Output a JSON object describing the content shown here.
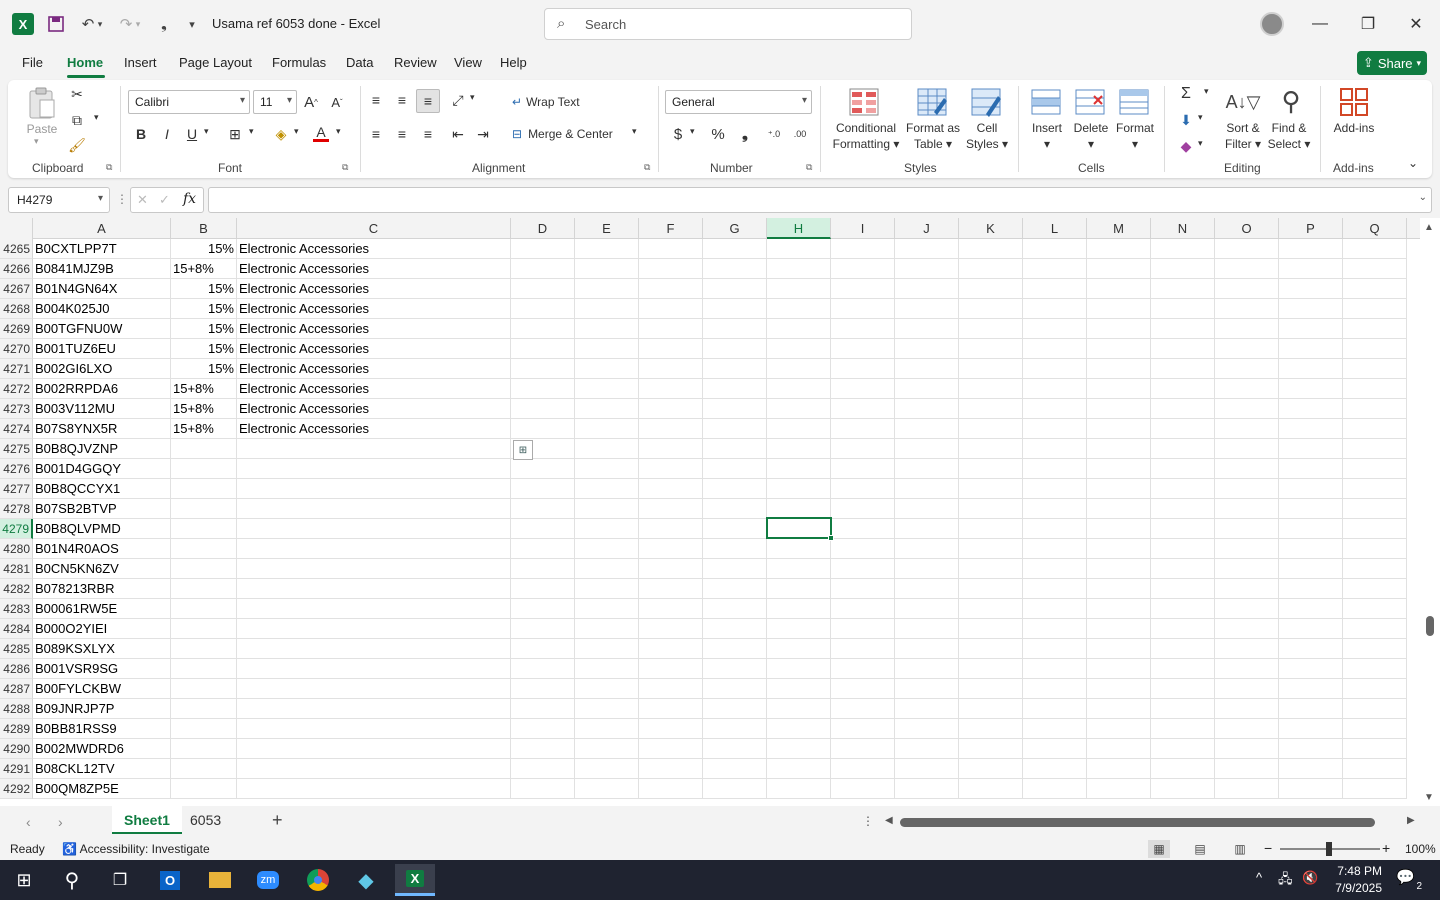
{
  "window": {
    "title": "Usama ref 6053 done  -  Excel",
    "search_placeholder": "Search"
  },
  "menu": {
    "tabs": [
      "File",
      "Home",
      "Insert",
      "Page Layout",
      "Formulas",
      "Data",
      "Review",
      "View",
      "Help"
    ],
    "share_label": "Share"
  },
  "ribbon": {
    "clipboard": {
      "paste": "Paste",
      "group": "Clipboard"
    },
    "font": {
      "name": "Calibri",
      "size": "11",
      "group": "Font"
    },
    "alignment": {
      "wrap": "Wrap Text",
      "merge": "Merge & Center",
      "group": "Alignment"
    },
    "number": {
      "format": "General",
      "group": "Number"
    },
    "styles": {
      "conditional_1": "Conditional",
      "conditional_2": "Formatting",
      "format_table_1": "Format as",
      "format_table_2": "Table",
      "cell_styles_1": "Cell",
      "cell_styles_2": "Styles",
      "group": "Styles"
    },
    "cells": {
      "insert": "Insert",
      "delete": "Delete",
      "format": "Format",
      "group": "Cells"
    },
    "editing": {
      "sort_1": "Sort &",
      "sort_2": "Filter",
      "find_1": "Find &",
      "find_2": "Select",
      "group": "Editing"
    },
    "addins": {
      "label": "Add-ins",
      "group": "Add-ins"
    }
  },
  "formula_bar": {
    "name_box": "H4279",
    "fx": "fx",
    "value": ""
  },
  "grid": {
    "columns": [
      "A",
      "B",
      "C",
      "D",
      "E",
      "F",
      "G",
      "H",
      "I",
      "J",
      "K",
      "L",
      "M",
      "N",
      "O",
      "P",
      "Q"
    ],
    "selected_column": "H",
    "selected_row": "4279",
    "rows": [
      {
        "num": "4265",
        "a": "B0CXTLPP7T",
        "b": "15%",
        "c": "Electronic Accessories"
      },
      {
        "num": "4266",
        "a": "B0841MJZ9B",
        "b": "15+8%",
        "c": "Electronic Accessories"
      },
      {
        "num": "4267",
        "a": "B01N4GN64X",
        "b": "15%",
        "c": "Electronic Accessories"
      },
      {
        "num": "4268",
        "a": "B004K025J0",
        "b": "15%",
        "c": "Electronic Accessories"
      },
      {
        "num": "4269",
        "a": "B00TGFNU0W",
        "b": "15%",
        "c": "Electronic Accessories"
      },
      {
        "num": "4270",
        "a": "B001TUZ6EU",
        "b": "15%",
        "c": "Electronic Accessories"
      },
      {
        "num": "4271",
        "a": "B002GI6LXO",
        "b": "15%",
        "c": "Electronic Accessories"
      },
      {
        "num": "4272",
        "a": "B002RRPDA6",
        "b": "15+8%",
        "c": "Electronic Accessories"
      },
      {
        "num": "4273",
        "a": "B003V112MU",
        "b": "15+8%",
        "c": "Electronic Accessories"
      },
      {
        "num": "4274",
        "a": "B07S8YNX5R",
        "b": "15+8%",
        "c": "Electronic Accessories"
      },
      {
        "num": "4275",
        "a": "B0B8QJVZNP",
        "b": "",
        "c": ""
      },
      {
        "num": "4276",
        "a": "B001D4GGQY",
        "b": "",
        "c": ""
      },
      {
        "num": "4277",
        "a": "B0B8QCCYX1",
        "b": "",
        "c": ""
      },
      {
        "num": "4278",
        "a": "B07SB2BTVP",
        "b": "",
        "c": ""
      },
      {
        "num": "4279",
        "a": "B0B8QLVPMD",
        "b": "",
        "c": ""
      },
      {
        "num": "4280",
        "a": "B01N4R0AOS",
        "b": "",
        "c": ""
      },
      {
        "num": "4281",
        "a": "B0CN5KN6ZV",
        "b": "",
        "c": ""
      },
      {
        "num": "4282",
        "a": "B078213RBR",
        "b": "",
        "c": ""
      },
      {
        "num": "4283",
        "a": "B00061RW5E",
        "b": "",
        "c": ""
      },
      {
        "num": "4284",
        "a": "B000O2YIEI",
        "b": "",
        "c": ""
      },
      {
        "num": "4285",
        "a": "B089KSXLYX",
        "b": "",
        "c": ""
      },
      {
        "num": "4286",
        "a": "B001VSR9SG",
        "b": "",
        "c": ""
      },
      {
        "num": "4287",
        "a": "B00FYLCKBW",
        "b": "",
        "c": ""
      },
      {
        "num": "4288",
        "a": "B09JNRJP7P",
        "b": "",
        "c": ""
      },
      {
        "num": "4289",
        "a": "B0BB81RSS9",
        "b": "",
        "c": ""
      },
      {
        "num": "4290",
        "a": "B002MWDRD6",
        "b": "",
        "c": ""
      },
      {
        "num": "4291",
        "a": "B08CKL12TV",
        "b": "",
        "c": ""
      },
      {
        "num": "4292",
        "a": "B00QM8ZP5E",
        "b": "",
        "c": ""
      }
    ]
  },
  "sheets": {
    "tabs": [
      "Sheet1",
      "6053"
    ],
    "active": "Sheet1"
  },
  "status": {
    "ready": "Ready",
    "accessibility": "Accessibility: Investigate",
    "zoom": "100%"
  },
  "taskbar": {
    "time": "7:48 PM",
    "date": "7/9/2025",
    "notifications": "2"
  },
  "colors": {
    "accent": "#107c41"
  }
}
